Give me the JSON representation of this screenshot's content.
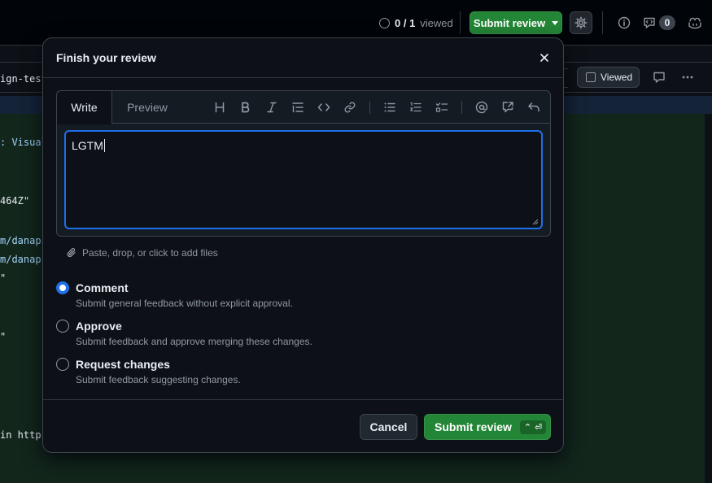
{
  "header": {
    "viewed_count": "0 / 1",
    "viewed_label": "viewed",
    "submit_review_label": "Submit review",
    "conversations_count": "0",
    "icons": [
      "circle-icon",
      "gear-icon",
      "info-icon",
      "comment-discussion-icon",
      "copilot-icon"
    ]
  },
  "file": {
    "name_fragment": "ign-test",
    "viewed_label": "Viewed"
  },
  "code": {
    "lines": [
      ": Visual",
      "464Z\"",
      "m/danapi",
      "m/danapi",
      "\"",
      "\"",
      "in https"
    ]
  },
  "modal": {
    "title": "Finish your review",
    "tabs": {
      "write": "Write",
      "preview": "Preview"
    },
    "toolbar_icons": [
      "heading-icon",
      "bold-icon",
      "italic-icon",
      "quote-icon",
      "code-icon",
      "link-icon",
      "unordered-list-icon",
      "ordered-list-icon",
      "task-list-icon",
      "mention-icon",
      "cross-reference-icon",
      "undo-icon"
    ],
    "comment_text": "LGTM",
    "attach_label": "Paste, drop, or click to add files",
    "options": [
      {
        "title": "Comment",
        "description": "Submit general feedback without explicit approval.",
        "checked": true
      },
      {
        "title": "Approve",
        "description": "Submit feedback and approve merging these changes.",
        "checked": false
      },
      {
        "title": "Request changes",
        "description": "Submit feedback suggesting changes.",
        "checked": false
      }
    ],
    "cancel_label": "Cancel",
    "submit_label": "Submit review",
    "submit_shortcut": "⌃ ⏎"
  },
  "colors": {
    "accent_blue": "#1f6feb",
    "primary_green": "#238636",
    "background": "#0d1117",
    "added_line_bg": "#12261c"
  }
}
